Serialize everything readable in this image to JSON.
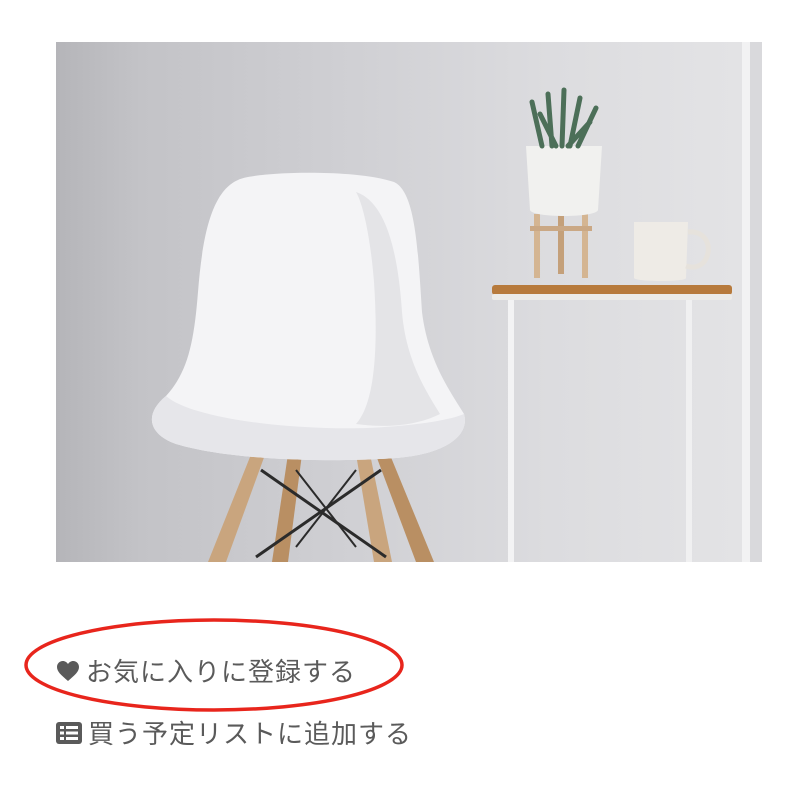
{
  "product_image": {
    "alt": ""
  },
  "actions": {
    "favorite": {
      "icon": "heart-icon",
      "label": "お気に入りに登録する"
    },
    "buy_list": {
      "icon": "list-icon",
      "label": "買う予定リストに追加する"
    }
  },
  "colors": {
    "text": "#5a5a5a",
    "highlight": "#e8251c"
  }
}
